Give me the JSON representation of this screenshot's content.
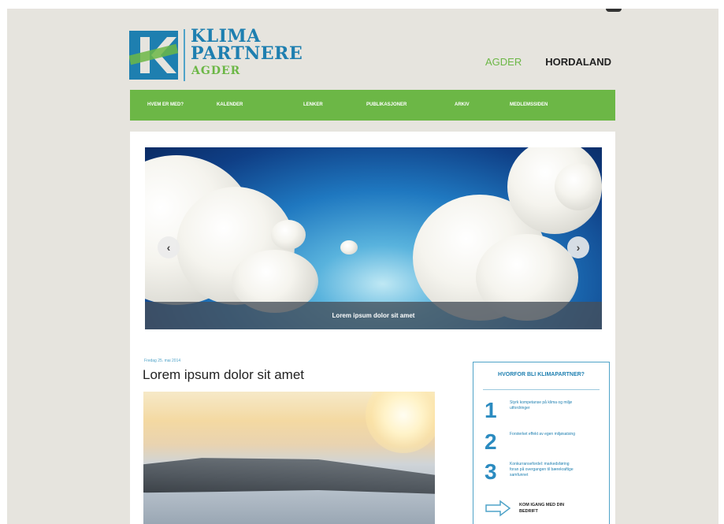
{
  "logo": {
    "line1": "KLIMA",
    "line2": "PARTNERE",
    "line3": "AGDER",
    "colors": {
      "blue": "#1e7fb0",
      "green": "#6cb746"
    }
  },
  "regions": {
    "agder": "AGDER",
    "hordaland": "HORDALAND"
  },
  "nav": {
    "items": [
      {
        "label": "HVEM ER MED?"
      },
      {
        "label": "KALENDER"
      },
      {
        "label": "LENKER"
      },
      {
        "label": "PUBLIKASJONER"
      },
      {
        "label": "ARKIV"
      },
      {
        "label": "MEDLEMSSIDEN"
      }
    ],
    "color": "#6cb746"
  },
  "hero": {
    "caption": "Lorem ipsum dolor sit amet",
    "prev_icon": "chevron-left-icon",
    "next_icon": "chevron-right-icon"
  },
  "post": {
    "date": "Fredag 25. mai 2014",
    "title": "Lorem ipsum dolor sit amet"
  },
  "why": {
    "title": "HVORFOR BLI KLIMAPARTNER?",
    "items": [
      {
        "num": "1",
        "text": "Styrk kompetanse på klima og miljø utfordringer"
      },
      {
        "num": "2",
        "text": "Forsterket effekt av egen miljøsatsing"
      },
      {
        "num": "3",
        "text": "Konkurransefordel: markedsføring foran på overgangen til bærekraftige samfunnet"
      }
    ],
    "cta": "KOM IGANG MED DIN BEDRIFT",
    "cta_icon": "arrow-right-icon"
  }
}
